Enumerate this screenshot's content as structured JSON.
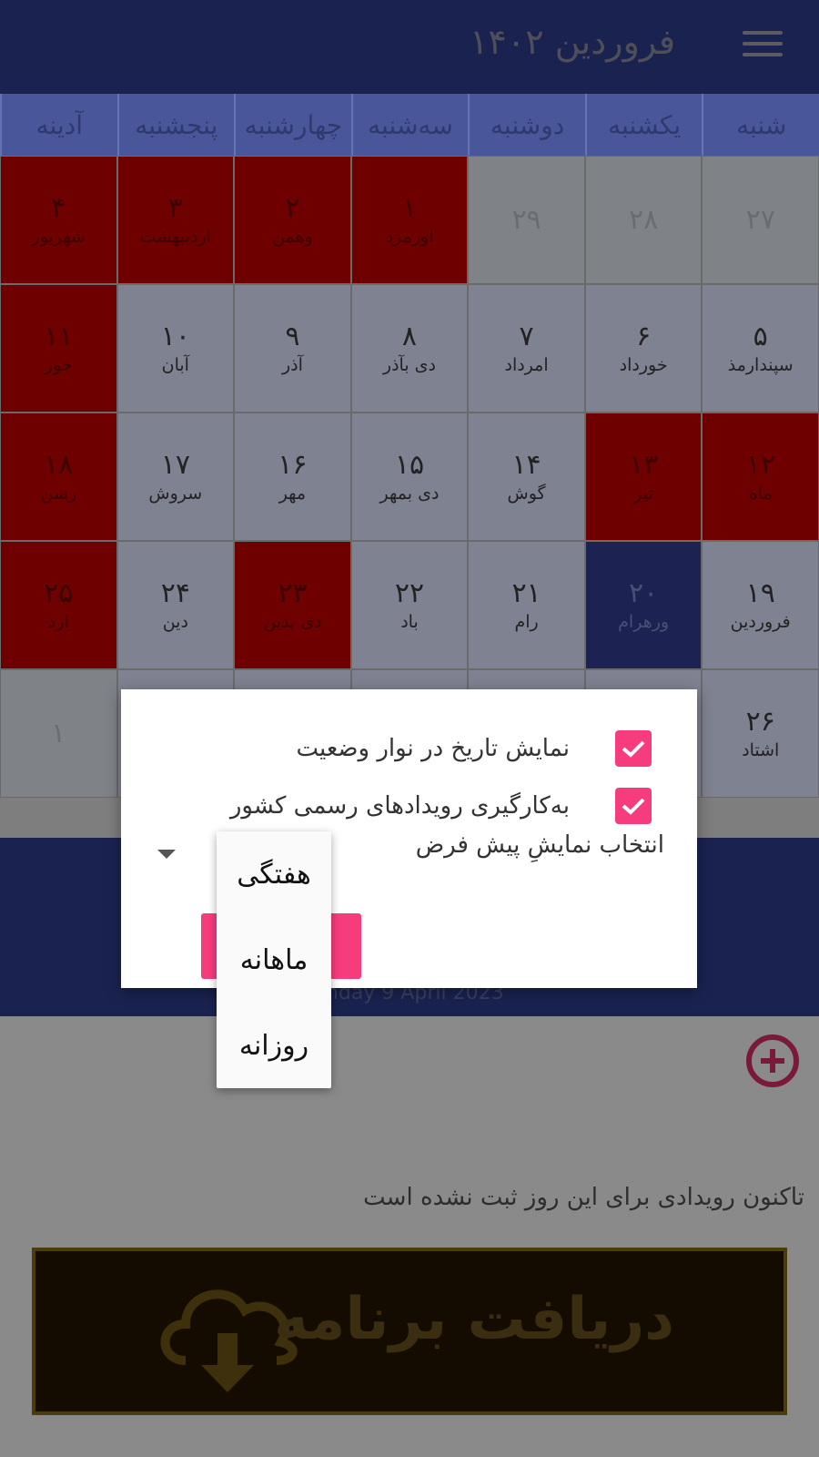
{
  "header": {
    "title": "فروردین ۱۴۰۲",
    "menu_icon": "hamburger-icon"
  },
  "weekdays": [
    "شنبه",
    "یکشنبه",
    "دوشنبه",
    "سه‌شنبه",
    "چهارشنبه",
    "پنجشنبه",
    "آدینه"
  ],
  "calendar": {
    "rows": [
      [
        {
          "n": "۲۷",
          "s": "",
          "t": "gray"
        },
        {
          "n": "۲۸",
          "s": "",
          "t": "gray"
        },
        {
          "n": "۲۹",
          "s": "",
          "t": "gray"
        },
        {
          "n": "۱",
          "s": "اورمزد",
          "t": "red"
        },
        {
          "n": "۲",
          "s": "وهمن",
          "t": "red"
        },
        {
          "n": "۳",
          "s": "اردیبهشت",
          "t": "red"
        },
        {
          "n": "۴",
          "s": "شهریور",
          "t": "red"
        }
      ],
      [
        {
          "n": "۵",
          "s": "سپندارمذ",
          "t": ""
        },
        {
          "n": "۶",
          "s": "خورداد",
          "t": ""
        },
        {
          "n": "۷",
          "s": "امرداد",
          "t": ""
        },
        {
          "n": "۸",
          "s": "دی بآذر",
          "t": ""
        },
        {
          "n": "۹",
          "s": "آذر",
          "t": ""
        },
        {
          "n": "۱۰",
          "s": "آبان",
          "t": ""
        },
        {
          "n": "۱۱",
          "s": "خور",
          "t": "red"
        }
      ],
      [
        {
          "n": "۱۲",
          "s": "ماه",
          "t": "red"
        },
        {
          "n": "۱۳",
          "s": "تیر",
          "t": "red"
        },
        {
          "n": "۱۴",
          "s": "گوش",
          "t": ""
        },
        {
          "n": "۱۵",
          "s": "دی بمهر",
          "t": ""
        },
        {
          "n": "۱۶",
          "s": "مهر",
          "t": ""
        },
        {
          "n": "۱۷",
          "s": "سروش",
          "t": ""
        },
        {
          "n": "۱۸",
          "s": "رشن",
          "t": "red"
        }
      ],
      [
        {
          "n": "۱۹",
          "s": "فروردین",
          "t": ""
        },
        {
          "n": "۲۰",
          "s": "ورهرام",
          "t": "sel"
        },
        {
          "n": "۲۱",
          "s": "رام",
          "t": ""
        },
        {
          "n": "۲۲",
          "s": "باد",
          "t": ""
        },
        {
          "n": "۲۳",
          "s": "دی بدین",
          "t": "red"
        },
        {
          "n": "۲۴",
          "s": "دین",
          "t": ""
        },
        {
          "n": "۲۵",
          "s": "ارد",
          "t": "red"
        }
      ],
      [
        {
          "n": "۲۶",
          "s": "اشتاد",
          "t": ""
        },
        {
          "n": "",
          "s": "",
          "t": ""
        },
        {
          "n": "",
          "s": "",
          "t": ""
        },
        {
          "n": "",
          "s": "",
          "t": ""
        },
        {
          "n": "",
          "s": "",
          "t": ""
        },
        {
          "n": "",
          "s": "",
          "t": ""
        },
        {
          "n": "۱",
          "s": "",
          "t": "gray"
        }
      ]
    ]
  },
  "date_english": "Sunday 9 April 2023",
  "events": {
    "empty_text": "تاکنون رویدادی برای این روز ثبت نشده است",
    "add_icon": "plus-circle-icon"
  },
  "banner": {
    "text": "دریافت برنامه",
    "icon": "cloud-download-icon"
  },
  "dialog": {
    "option1": "نمایش تاریخ در نوار وضعیت",
    "option2": "به‌کارگیری رویدادهای رسمی کشور",
    "select_label": "انتخاب نمایشِ پیش فرض",
    "dropdown_options": [
      "هفتگی",
      "ماهانه",
      "روزانه"
    ]
  },
  "colors": {
    "accent": "#f73c7e",
    "header": "#1a2250",
    "holiday": "#6e0000"
  }
}
